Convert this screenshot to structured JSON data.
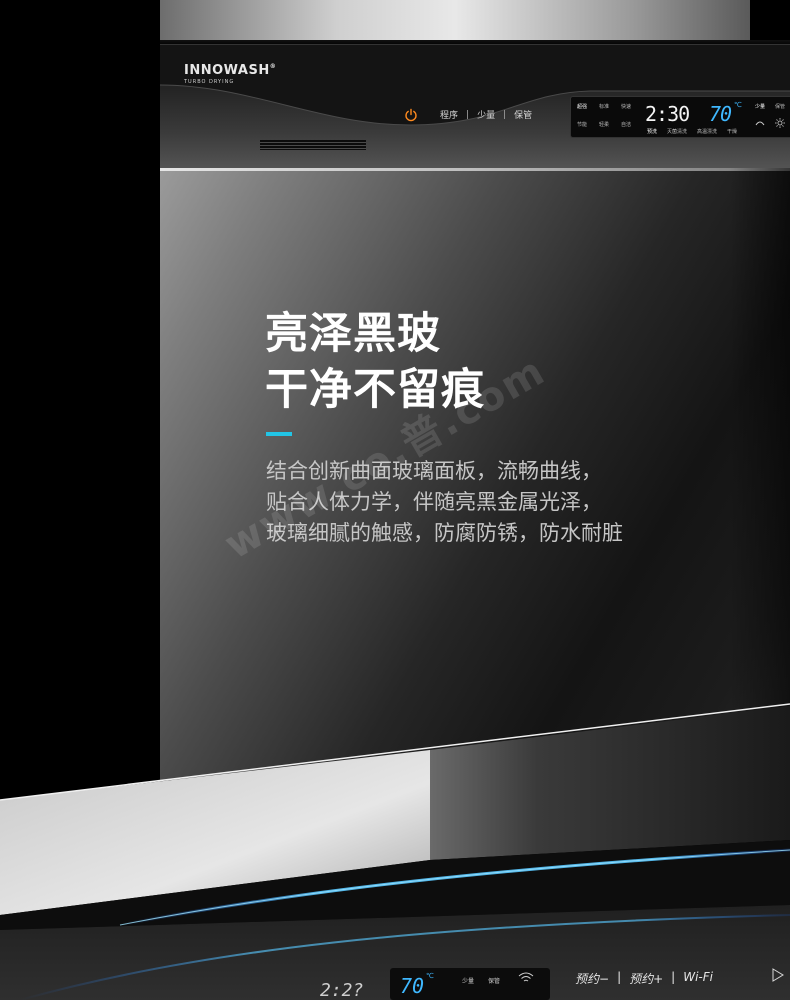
{
  "brand": {
    "name": "INNOWASH",
    "registered": "®",
    "tagline": "TURBO DRYING"
  },
  "panel": {
    "menu": [
      "程序",
      "少量",
      "保管"
    ],
    "separator": "|",
    "display": {
      "top_labels": [
        "超强",
        "标准",
        "快速"
      ],
      "bottom_labels": [
        "节能",
        "轻柔",
        "自洁"
      ],
      "status_labels": [
        "预洗",
        "灭菌清洗",
        "高温漂洗",
        "干燥"
      ],
      "right_top_labels": [
        "少量",
        "保管"
      ],
      "time": "2:30",
      "temperature": "70",
      "temperature_unit": "℃"
    }
  },
  "headline": {
    "line1": "亮泽黑玻",
    "line2": "干净不留痕"
  },
  "body": {
    "line1": "结合创新曲面玻璃面板，流畅曲线，",
    "line2": "贴合人体力学，伴随亮黑金属光泽，",
    "line3": "玻璃细腻的触感，防腐防锈，防水耐脏"
  },
  "watermark": "www.co.普.com",
  "bottom": {
    "time": "2:2?",
    "temperature": "70",
    "temperature_unit": "℃",
    "labels": [
      "少量",
      "保管"
    ],
    "menu": [
      "预约−",
      "|",
      "预约+",
      "|",
      "Wi-Fi"
    ]
  },
  "colors": {
    "accent": "#22c5e6",
    "display_blue": "#3fb8ff",
    "power_orange": "#ff8a1e"
  }
}
